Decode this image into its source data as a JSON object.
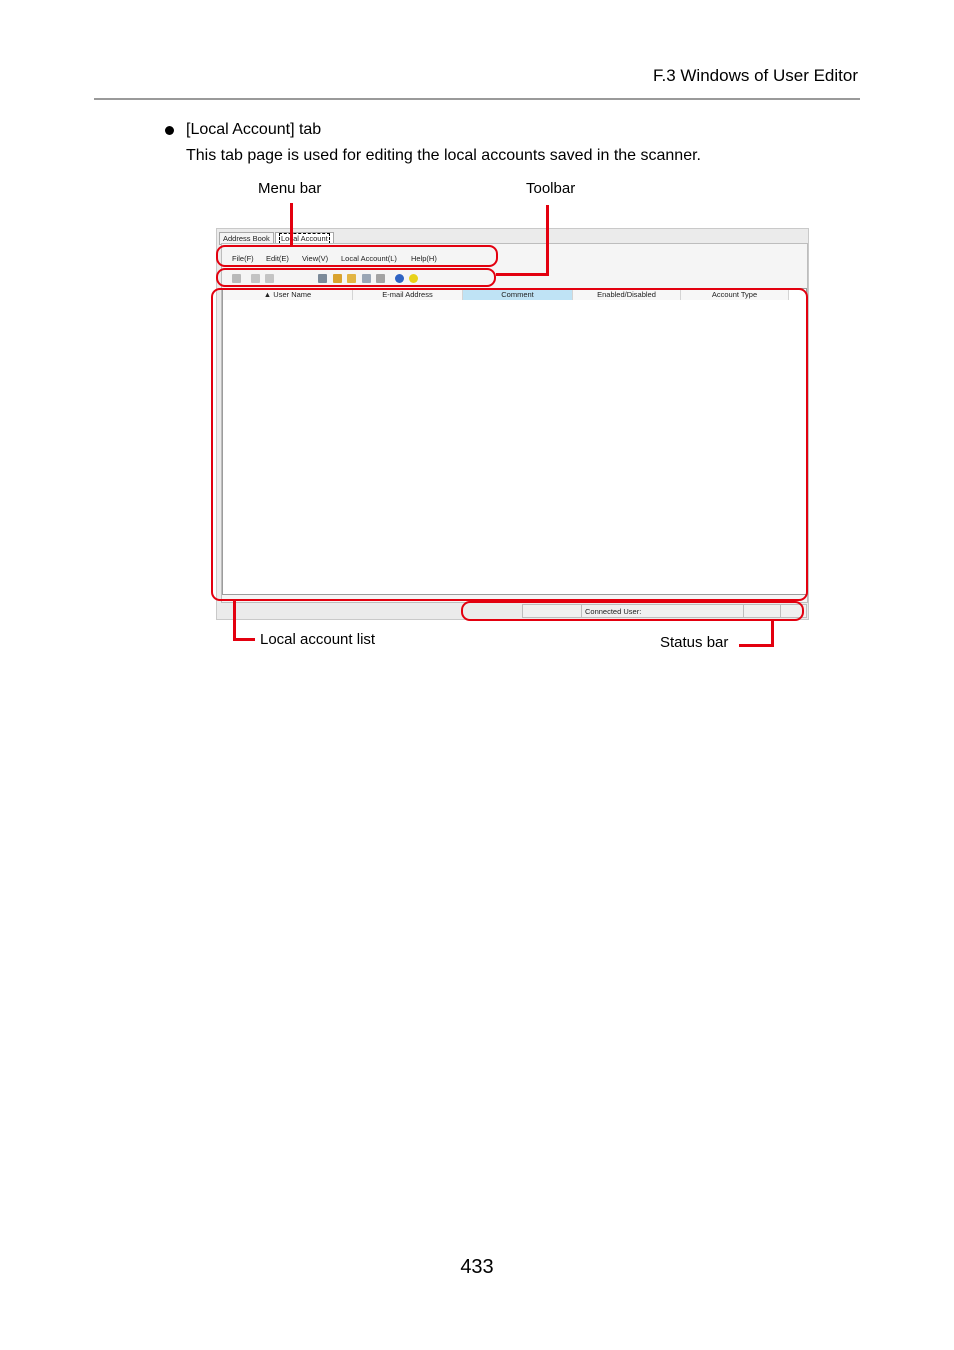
{
  "header": {
    "section_title": "F.3 Windows of User Editor"
  },
  "bullet": {
    "title": "[Local Account] tab",
    "description": "This tab page is used for editing the local accounts saved in the scanner."
  },
  "callouts": {
    "menu_bar": "Menu bar",
    "toolbar": "Toolbar",
    "local_account_list": "Local account list",
    "status_bar": "Status bar"
  },
  "screenshot": {
    "tabs": [
      "Address Book",
      "Local Account"
    ],
    "menu": [
      "File(F)",
      "Edit(E)",
      "View(V)",
      "Local Account(L)",
      "Help(H)"
    ],
    "toolbar_icons": [
      "add-user-icon",
      "edit-icon",
      "delete-icon",
      "user-icon",
      "import-icon",
      "export-icon",
      "copy-icon",
      "save-icon",
      "info-icon",
      "help-icon"
    ],
    "columns": [
      "User Name",
      "E-mail Address",
      "Comment",
      "Enabled/Disabled",
      "Account Type"
    ],
    "status": {
      "connected_user_label": "Connected User:"
    },
    "colors": {
      "highlight_column": "#bfe3f5",
      "callout_red": "#e3000f"
    }
  },
  "footer": {
    "page_number": "433"
  }
}
